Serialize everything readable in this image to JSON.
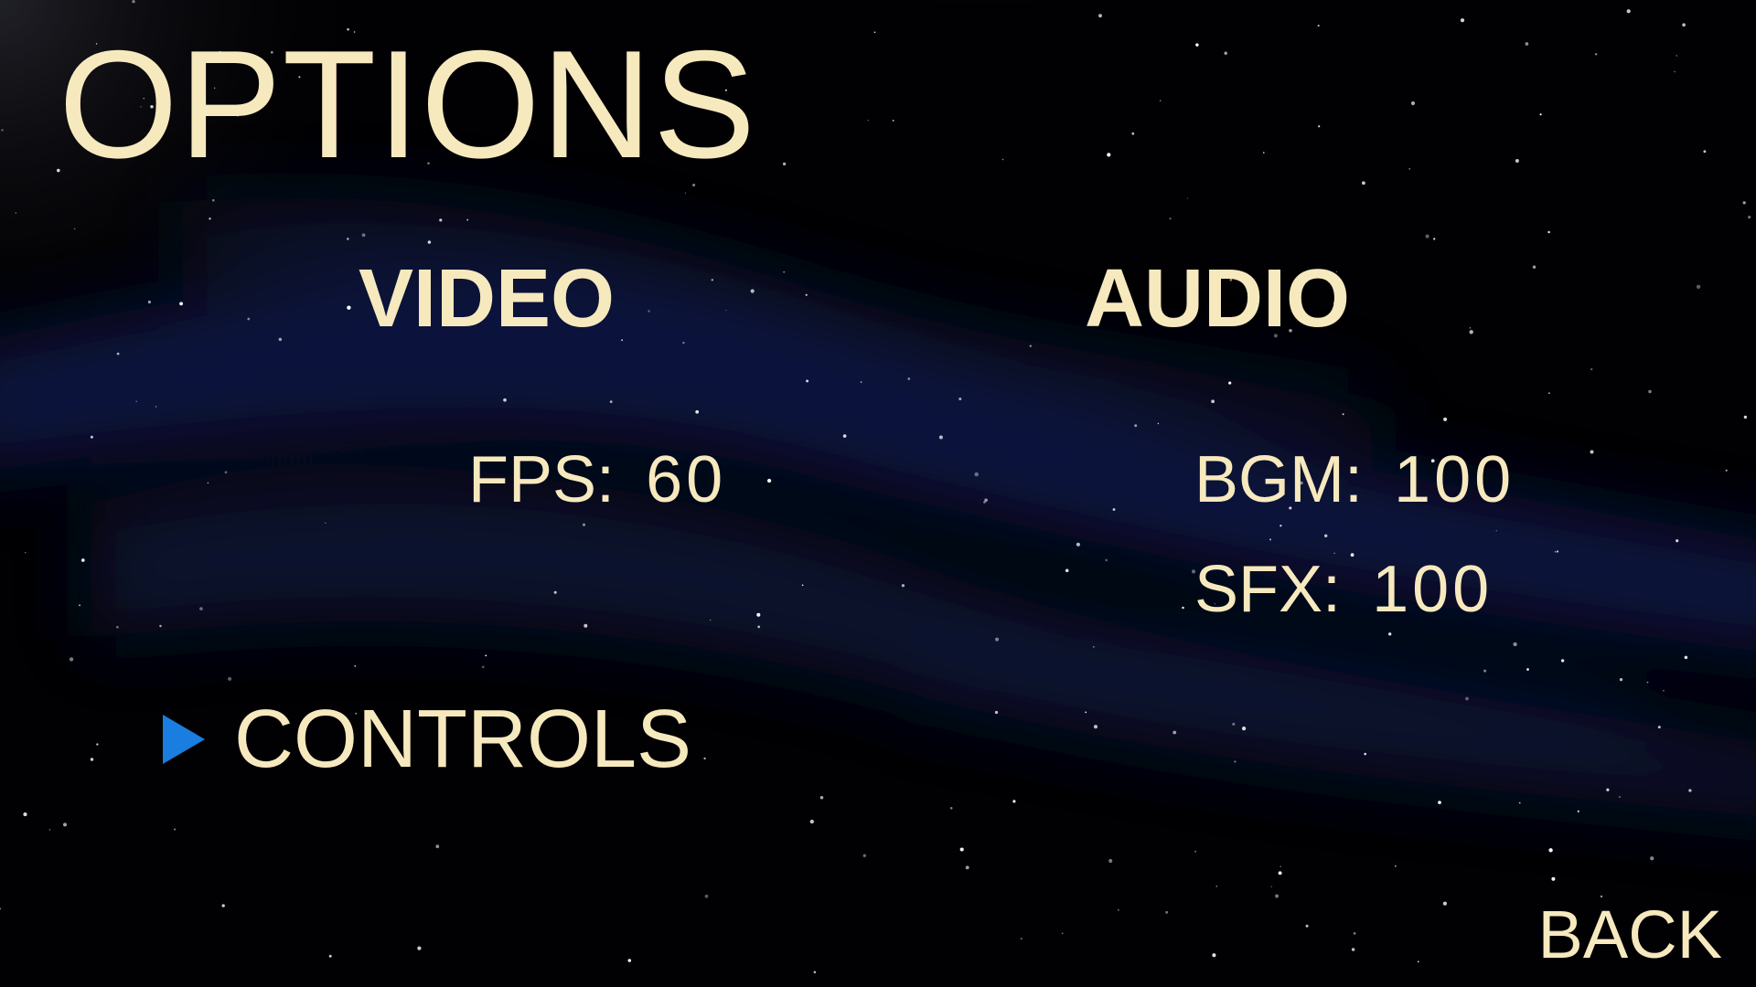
{
  "screen": {
    "title": "OPTIONS",
    "back_label": "BACK"
  },
  "video": {
    "heading": "VIDEO",
    "settings": [
      {
        "label": "FPS:",
        "value": "60"
      }
    ]
  },
  "audio": {
    "heading": "AUDIO",
    "settings": [
      {
        "label": "BGM:",
        "value": "100"
      },
      {
        "label": "SFX:",
        "value": "100"
      }
    ]
  },
  "menu": {
    "selected_item": "CONTROLS",
    "cursor_icon": "triangle-right-icon"
  },
  "colors": {
    "text": "#f7e9be",
    "cursor": "#1a7de0",
    "background": "#010104",
    "nebula": "#0b1845"
  }
}
